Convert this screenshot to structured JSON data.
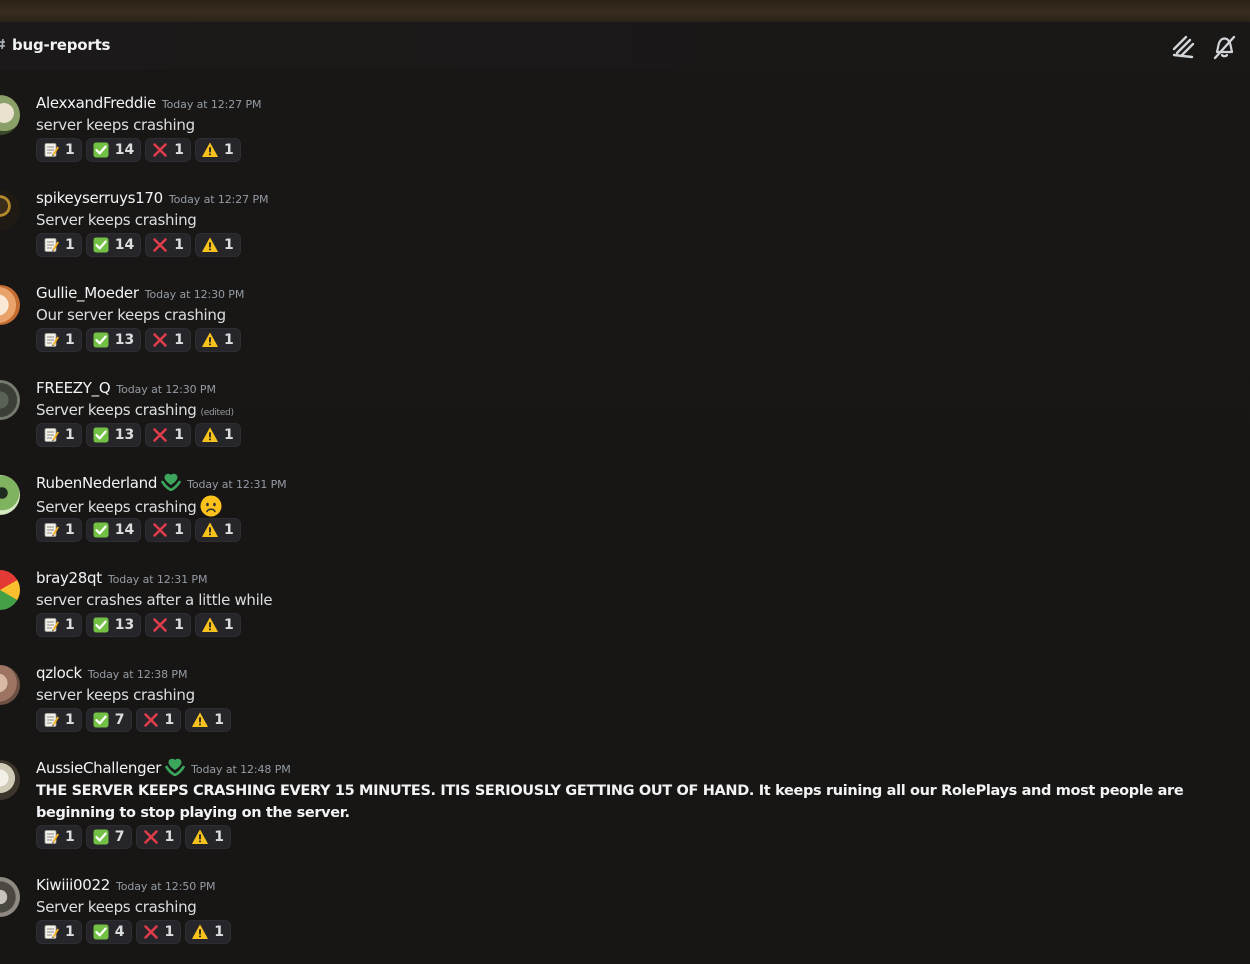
{
  "channel": {
    "name": "bug-reports"
  },
  "reaction_icons": [
    "memo-icon",
    "check-mark-icon",
    "cross-mark-icon",
    "warning-icon"
  ],
  "messages": [
    {
      "author": "AlexxandFreddie",
      "timestamp": "Today at 12:27 PM",
      "content": "server keeps crashing",
      "reactions": [
        "1",
        "14",
        "1",
        "1"
      ]
    },
    {
      "author": "spikeyserruys170",
      "timestamp": "Today at 12:27 PM",
      "content": "Server keeps crashing",
      "reactions": [
        "1",
        "14",
        "1",
        "1"
      ]
    },
    {
      "author": "Gullie_Moeder",
      "timestamp": "Today at 12:30 PM",
      "content": "Our server keeps crashing",
      "reactions": [
        "1",
        "13",
        "1",
        "1"
      ]
    },
    {
      "author": "FREEZY_Q",
      "timestamp": "Today at 12:30 PM",
      "content": "Server keeps crashing",
      "edited": "(edited)",
      "reactions": [
        "1",
        "13",
        "1",
        "1"
      ]
    },
    {
      "author": "RubenNederland",
      "timestamp": "Today at 12:31 PM",
      "content": "Server keeps crashing",
      "reactions": [
        "1",
        "14",
        "1",
        "1"
      ]
    },
    {
      "author": "bray28qt",
      "timestamp": "Today at 12:31 PM",
      "content": "server crashes after a little while",
      "reactions": [
        "1",
        "13",
        "1",
        "1"
      ]
    },
    {
      "author": "qzlock",
      "timestamp": "Today at 12:38 PM",
      "content": "server keeps crashing",
      "reactions": [
        "1",
        "7",
        "1",
        "1"
      ]
    },
    {
      "author": "AussieChallenger",
      "timestamp": "Today at 12:48 PM",
      "content": "THE SERVER KEEPS CRASHING EVERY 15 MINUTES. ITIS SERIOUSLY GETTING OUT OF HAND. It keeps ruining all our RolePlays and most people are beginning to stop playing on the server.",
      "reactions": [
        "1",
        "7",
        "1",
        "1"
      ]
    },
    {
      "author": "Kiwiii0022",
      "timestamp": "Today at 12:50 PM",
      "content": "Server keeps crashing",
      "reactions": [
        "1",
        "4",
        "1",
        "1"
      ]
    }
  ]
}
